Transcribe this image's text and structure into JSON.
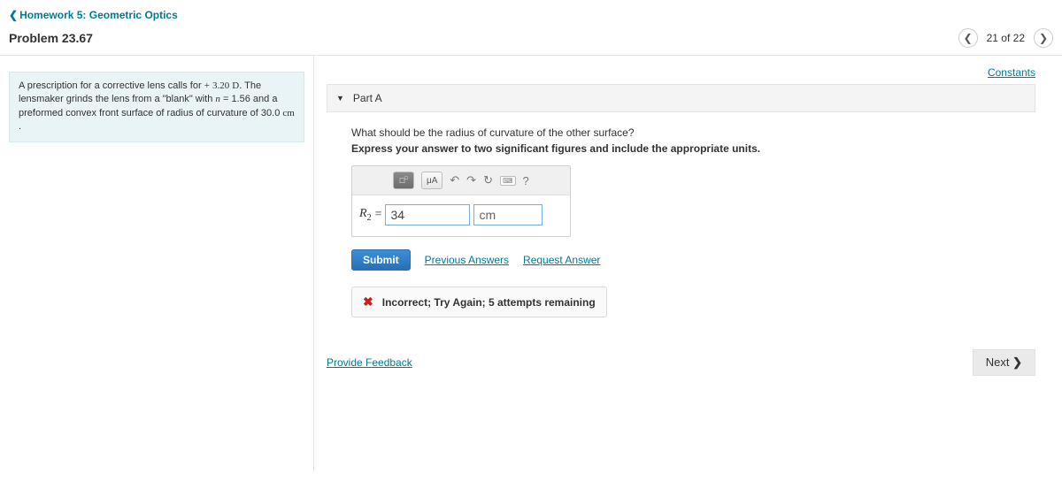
{
  "breadcrumb": {
    "label": "Homework 5: Geometric Optics"
  },
  "problem": {
    "title": "Problem 23.67"
  },
  "pager": {
    "position": "21 of 22"
  },
  "left": {
    "text_prefix": "A prescription for a corrective lens calls for ",
    "power_sign": "+",
    "power_value": "3.20",
    "power_unit": "D",
    "text_mid": ". The lensmaker grinds the lens from a \"blank\" with ",
    "n_sym": "n",
    "n_eq": " = 1.56 and a preformed convex front surface of radius of curvature of 30.0 ",
    "rc_unit": "cm",
    "text_end": " ."
  },
  "constants_label": "Constants",
  "part": {
    "label": "Part A",
    "question": "What should be the radius of curvature of the other surface?",
    "instruction": "Express your answer to two significant figures and include the appropriate units."
  },
  "toolbar": {
    "template_btn": "x□",
    "greek_btn": "μA",
    "help": "?"
  },
  "answer": {
    "symbol": "R",
    "subscript": "2",
    "equals": " = ",
    "value": "34",
    "unit": "cm"
  },
  "actions": {
    "submit": "Submit",
    "previous": "Previous Answers",
    "request": "Request Answer"
  },
  "feedback": {
    "text": "Incorrect; Try Again; 5 attempts remaining"
  },
  "bottom": {
    "provide_feedback": "Provide Feedback",
    "next": "Next"
  }
}
